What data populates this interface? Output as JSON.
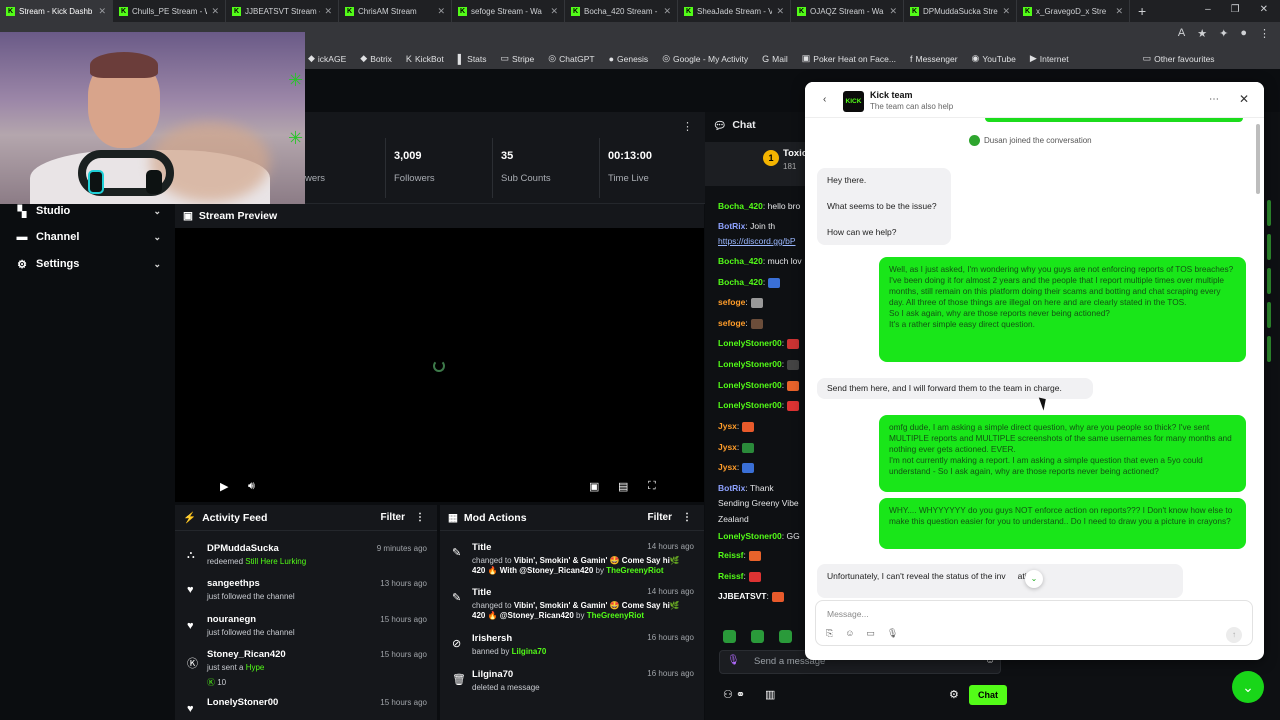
{
  "browser": {
    "tabs": [
      {
        "label": "Stream - Kick Dashb",
        "active": true
      },
      {
        "label": "Chulls_PE Stream - W"
      },
      {
        "label": "JJBEATSVT Stream -"
      },
      {
        "label": "ChrisAM Stream"
      },
      {
        "label": "sefoge Stream - Wa"
      },
      {
        "label": "Bocha_420 Stream -"
      },
      {
        "label": "SheaJade Stream - V"
      },
      {
        "label": "OJAQZ Stream - Wa"
      },
      {
        "label": "DPMuddaSucka Stre"
      },
      {
        "label": "x_GravegoD_x Stre"
      }
    ],
    "bookmarks": [
      "ickAGE",
      "Botrix",
      "KickBot",
      "Stats",
      "Stripe",
      "ChatGPT",
      "Genesis",
      "Google - My Activity",
      "Mail",
      "Poker Heat on Face...",
      "Messenger",
      "YouTube",
      "Internet"
    ],
    "other_bookmarks": "Other favourites"
  },
  "sidebar": {
    "items": [
      {
        "label": "Studio",
        "icon": "studio-icon"
      },
      {
        "label": "Channel",
        "icon": "channel-icon"
      },
      {
        "label": "Settings",
        "icon": "gear-icon"
      }
    ]
  },
  "stats": {
    "followers_label_partial": "wers",
    "items": [
      {
        "value": "3,009",
        "label": "Followers"
      },
      {
        "value": "35",
        "label": "Sub Counts"
      },
      {
        "value": "00:13:00",
        "label": "Time Live"
      }
    ]
  },
  "preview": {
    "title": "Stream Preview"
  },
  "activity_feed": {
    "title": "Activity Feed",
    "filter_label": "Filter",
    "items": [
      {
        "name": "DPMuddaSucka",
        "action": "redeemed ",
        "highlight": "Still Here Lurking",
        "time": "9 minutes ago",
        "icon": "reward-icon"
      },
      {
        "name": "sangeethps",
        "action": "just followed the channel",
        "highlight": "",
        "time": "13 hours ago",
        "icon": "heart-icon"
      },
      {
        "name": "nouranegn",
        "action": "just followed the channel",
        "highlight": "",
        "time": "15 hours ago",
        "icon": "heart-icon"
      },
      {
        "name": "Stoney_Rican420",
        "action": "just sent a ",
        "highlight": "Hype",
        "extra": "10",
        "time": "15 hours ago",
        "icon": "kick-icon"
      },
      {
        "name": "LonelyStoner00",
        "action": "",
        "highlight": "",
        "time": "15 hours ago",
        "icon": "heart-icon"
      }
    ]
  },
  "mod_actions": {
    "title": "Mod Actions",
    "filter_label": "Filter",
    "items": [
      {
        "name": "Title",
        "line1_a": "changed to ",
        "line1_b": "Vibin', Smokin' & Gamin' 🤩 Come Say hi🌿",
        "line2_a": "420 🔥 With @Stoney_Rican420",
        "line2_b": " by ",
        "line2_c": "TheGreenyRiot",
        "time": "14 hours ago",
        "icon": "edit-icon"
      },
      {
        "name": "Title",
        "line1_a": "changed to ",
        "line1_b": "Vibin', Smokin' & Gamin' 🤩 Come Say hi🌿",
        "line2_a": "420 🔥 @Stoney_Rican420",
        "line2_b": " by ",
        "line2_c": "TheGreenyRiot",
        "time": "14 hours ago",
        "icon": "edit-icon"
      },
      {
        "name": "Irishersh",
        "line1_a": "banned by ",
        "line1_b": "",
        "line2_a": "",
        "line2_b": "",
        "line2_c": "",
        "hl": "Lilgina70",
        "time": "16 hours ago",
        "icon": "ban-icon"
      },
      {
        "name": "Lilgina70",
        "line1_a": "deleted a message",
        "line1_b": "",
        "line2_a": "",
        "line2_b": "",
        "line2_c": "",
        "time": "16 hours ago",
        "icon": "trash-icon"
      }
    ]
  },
  "chat": {
    "title": "Chat",
    "pinned": {
      "name": "Toxic",
      "count": "181",
      "badge": "1"
    },
    "messages": [
      {
        "user": "Bocha_420",
        "text": ": hello bro",
        "color": "g"
      },
      {
        "user": "BotRix",
        "text": ": Join th",
        "color": "lb"
      },
      {
        "user": "",
        "text": "https://discord.gg/bP",
        "color": "link"
      },
      {
        "user": "Bocha_420",
        "text": ": much lov",
        "color": "g"
      },
      {
        "user": "Bocha_420",
        "text": ":",
        "color": "g"
      },
      {
        "user": "sefoge",
        "text": ":",
        "color": "o"
      },
      {
        "user": "sefoge",
        "text": ":",
        "color": "o"
      },
      {
        "user": "LonelyStoner00",
        "text": ":",
        "color": "g"
      },
      {
        "user": "LonelyStoner00",
        "text": ":",
        "color": "g"
      },
      {
        "user": "LonelyStoner00",
        "text": ":",
        "color": "g"
      },
      {
        "user": "LonelyStoner00",
        "text": ":",
        "color": "g"
      },
      {
        "user": "Jysx",
        "text": ":",
        "color": "o"
      },
      {
        "user": "Jysx",
        "text": ":",
        "color": "o"
      },
      {
        "user": "Jysx",
        "text": ":",
        "color": "o"
      },
      {
        "user": "BotRix",
        "text": ": Thank",
        "color": "lb"
      },
      {
        "user": "",
        "text": "Sending Greeny Vibe",
        "color": "w"
      },
      {
        "user": "",
        "text": "Zealand",
        "color": "w"
      },
      {
        "user": "LonelyStoner00",
        "text": ": GG",
        "color": "g"
      },
      {
        "user": "Reissf",
        "text": ":",
        "color": "g"
      },
      {
        "user": "Reissf",
        "text": ":",
        "color": "g"
      },
      {
        "user": "JJBEATSVT",
        "text": ":",
        "color": "w"
      }
    ],
    "input_placeholder": "Send a message",
    "send_label": "Chat"
  },
  "support": {
    "title": "Kick team",
    "subtitle": "The team can also help",
    "logo": "KICK",
    "joined": "Dusan joined the conversation",
    "msg1": [
      "Hey there.",
      "What seems to be the issue?",
      "How can we help?"
    ],
    "msg2": "Well, as I just asked, I'm wondering why you guys are not enforcing reports of TOS breaches? I've been doing it for almost 2 years and the people that I report multiple times over multiple months, still remain on this platform doing their scams and botting and chat scraping every day. All three of those things are illegal on here and are clearly stated in the TOS.\nSo I ask again, why are those reports never being actioned?\nIt's a rather simple easy direct question.",
    "msg3": "Send them here, and I will forward them to the team in charge.",
    "msg4": "omfg dude, I am asking a simple direct question, why are you people so thick? I've sent MULTIPLE reports and MULTIPLE screenshots of the same usernames for many months and nothing ever gets actioned. EVER.\nI'm not currently making a report. I am asking a simple question that even a 5yo could understand - So I ask again, why are those reports never being actioned?",
    "msg5": "WHY.... WHYYYYYY do you guys NOT enforce action on reports??? I Don't know how else to make this question easier for you to understand.. Do I need to draw you a picture in crayons?",
    "msg6a": "Unfortunately, I can't reveal the status of the inv",
    "msg6b": "ation.",
    "compose_placeholder": "Message..."
  },
  "colors": {
    "kick_green": "#53fc18",
    "bubble_green": "#19e619",
    "background": "#0b0d10"
  }
}
